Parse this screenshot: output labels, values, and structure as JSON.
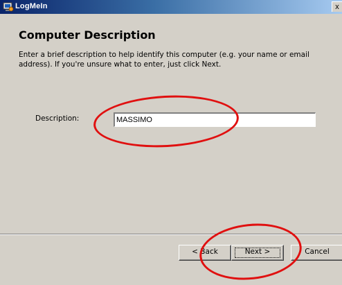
{
  "window": {
    "title": "LogMeIn",
    "close_label": "x"
  },
  "page": {
    "heading": "Computer Description",
    "intro": "Enter a brief description to help identify this computer (e.g. your name or email address). If you're unsure what to enter, just click Next."
  },
  "form": {
    "description_label": "Description:",
    "description_value": "MASSIMO"
  },
  "buttons": {
    "back": "< Back",
    "next": "Next >",
    "cancel": "Cancel"
  },
  "colors": {
    "titlebar_start": "#0a246a",
    "titlebar_end": "#a6caf0",
    "dialog_bg": "#d4d0c8",
    "annotation": "#e01010"
  },
  "icons": {
    "app": "logmein-app-icon",
    "close": "close-icon"
  }
}
